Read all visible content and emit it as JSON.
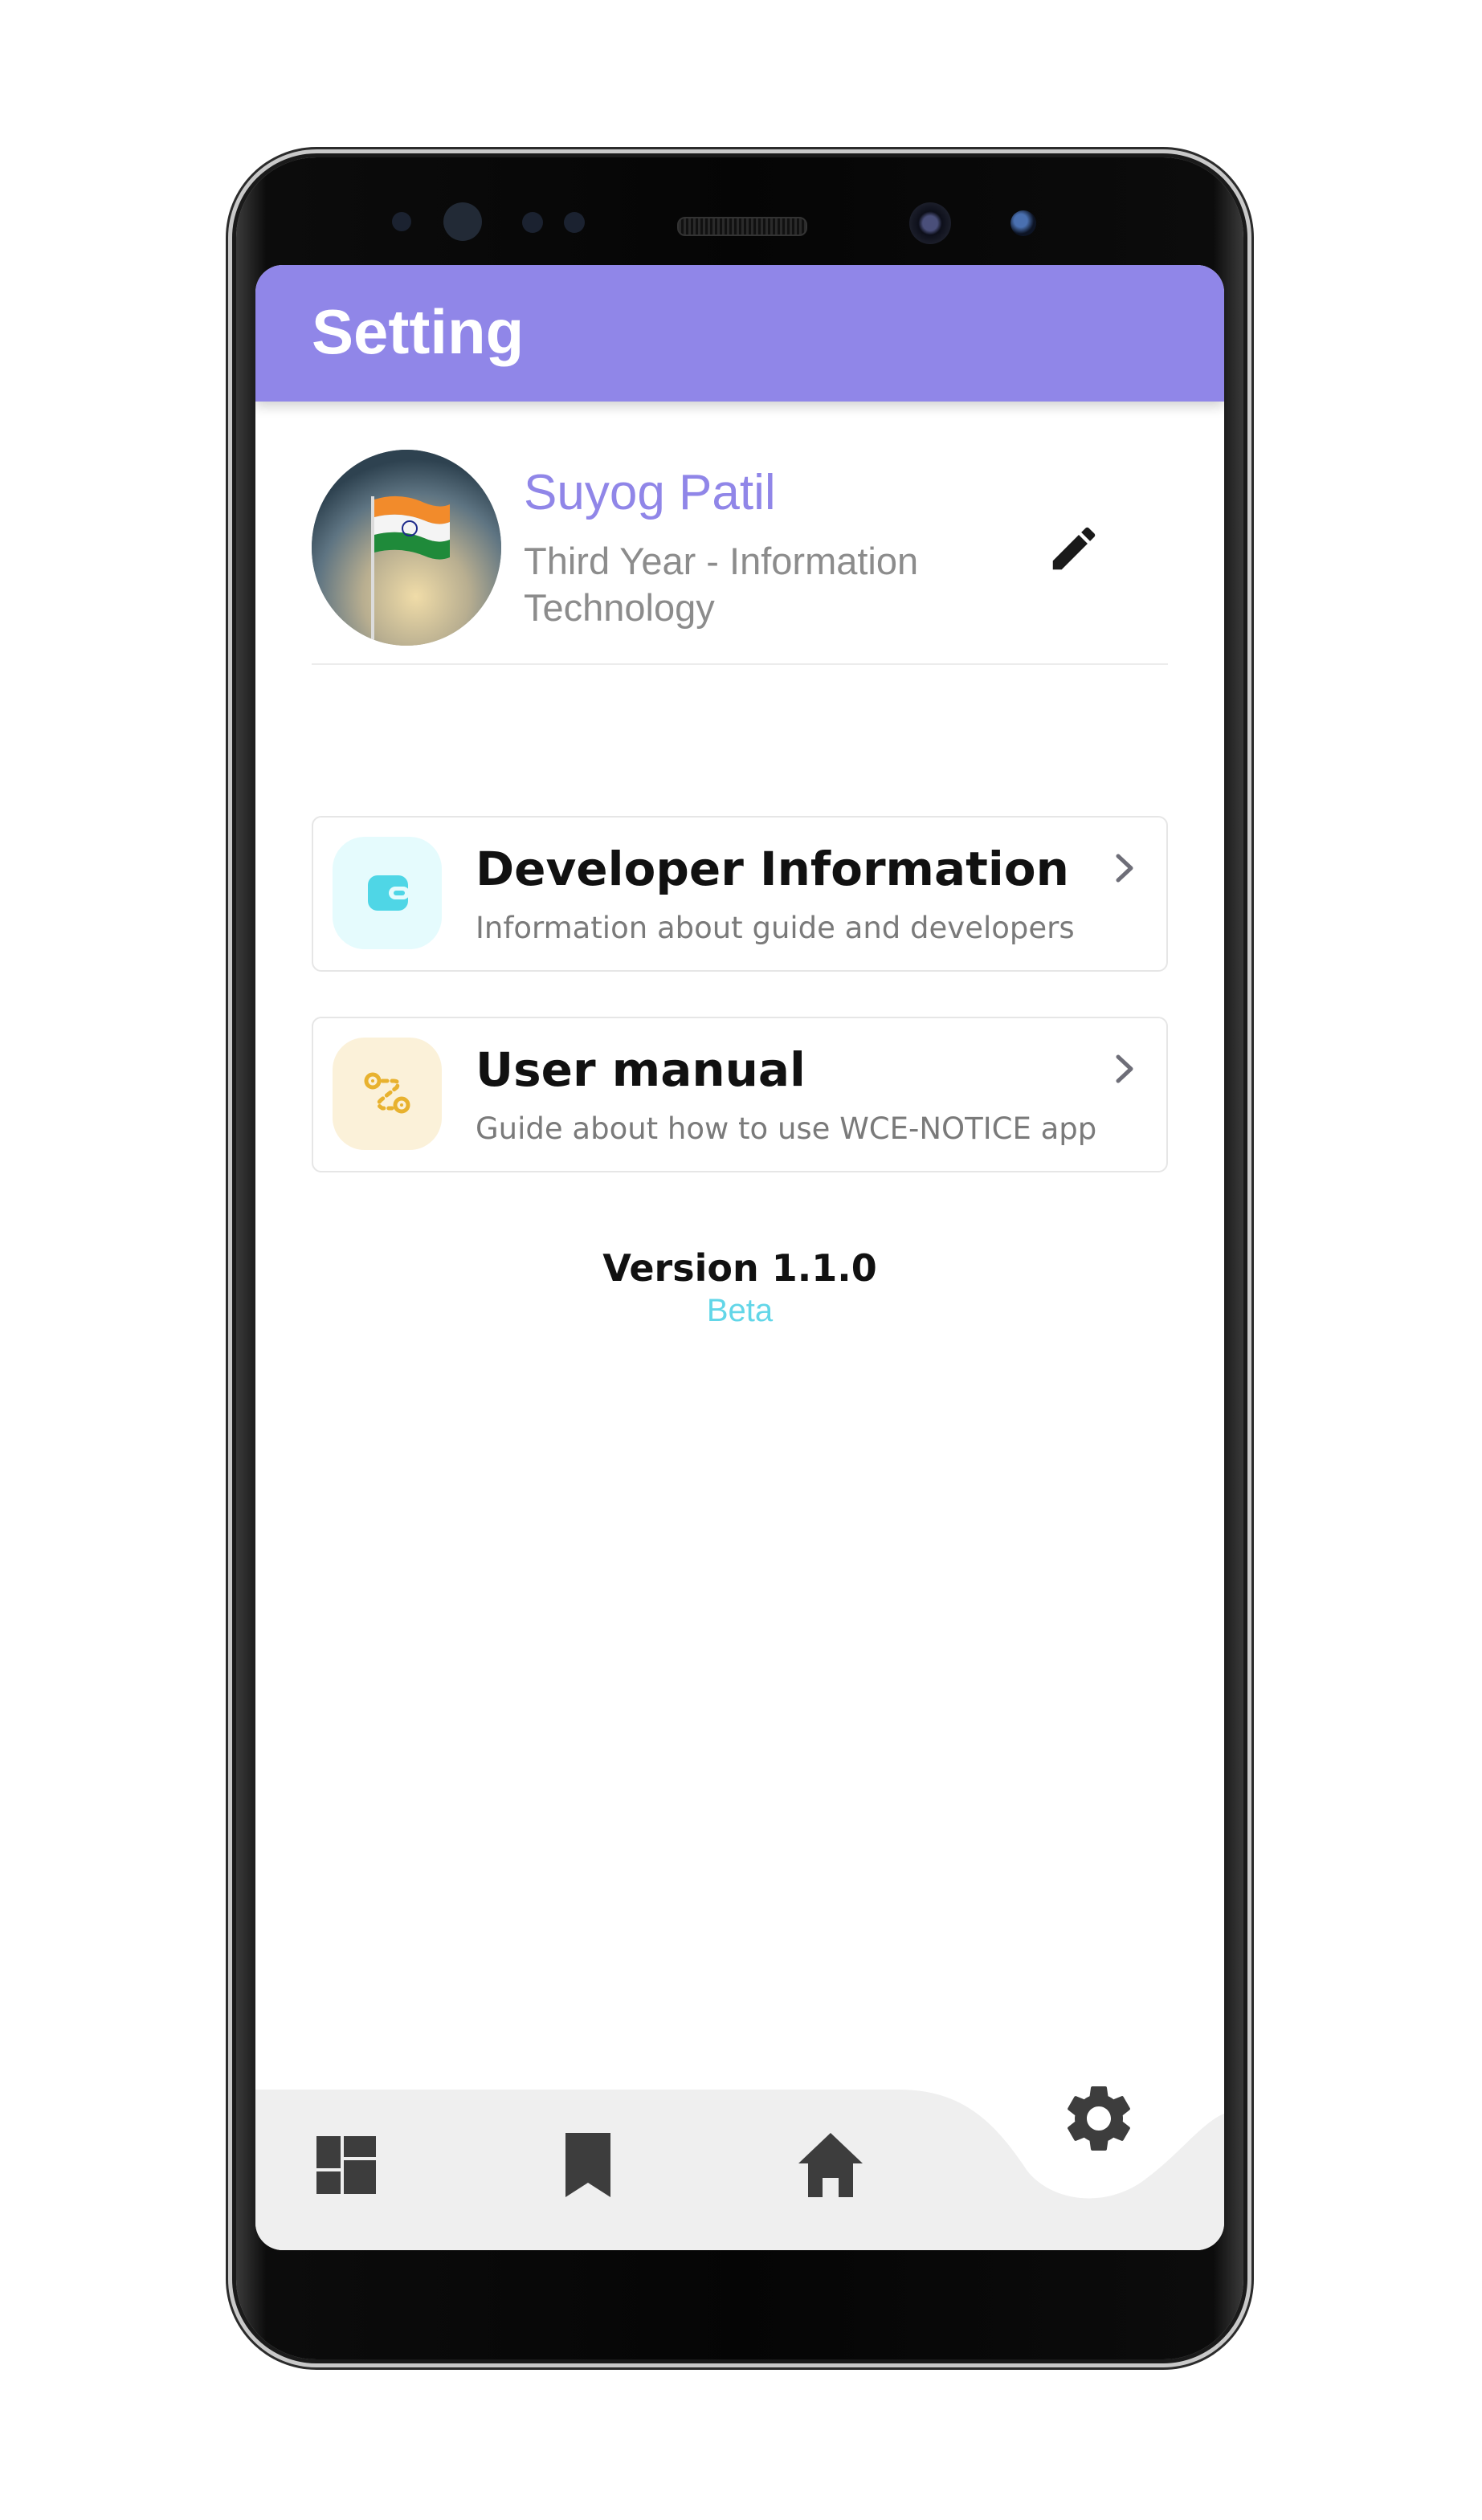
{
  "app": {
    "title": "Setting",
    "accent_color": "#9086e8",
    "beta_color": "#62d6e8"
  },
  "profile": {
    "name": "Suyog Patil",
    "subtitle": "Third Year - Information Technology",
    "avatar": "indian-flag-photo",
    "edit_icon": "pencil-icon"
  },
  "menu": [
    {
      "title": "Developer Information",
      "subtitle": "Information about guide and developers",
      "icon": "wallet-icon",
      "icon_color": "#4fd6e6",
      "icon_bg": "#e5fbfd"
    },
    {
      "title": "User manual",
      "subtitle": "Guide about how to use WCE-NOTICE app",
      "icon": "route-icon",
      "icon_color": "#e8b22f",
      "icon_bg": "#fbf1d9"
    }
  ],
  "version": {
    "label": "Version 1.1.0",
    "channel": "Beta"
  },
  "bottom_nav": {
    "items": [
      "dashboard-icon",
      "bookmark-icon",
      "home-icon",
      "gear-icon"
    ],
    "active": "gear-icon"
  }
}
